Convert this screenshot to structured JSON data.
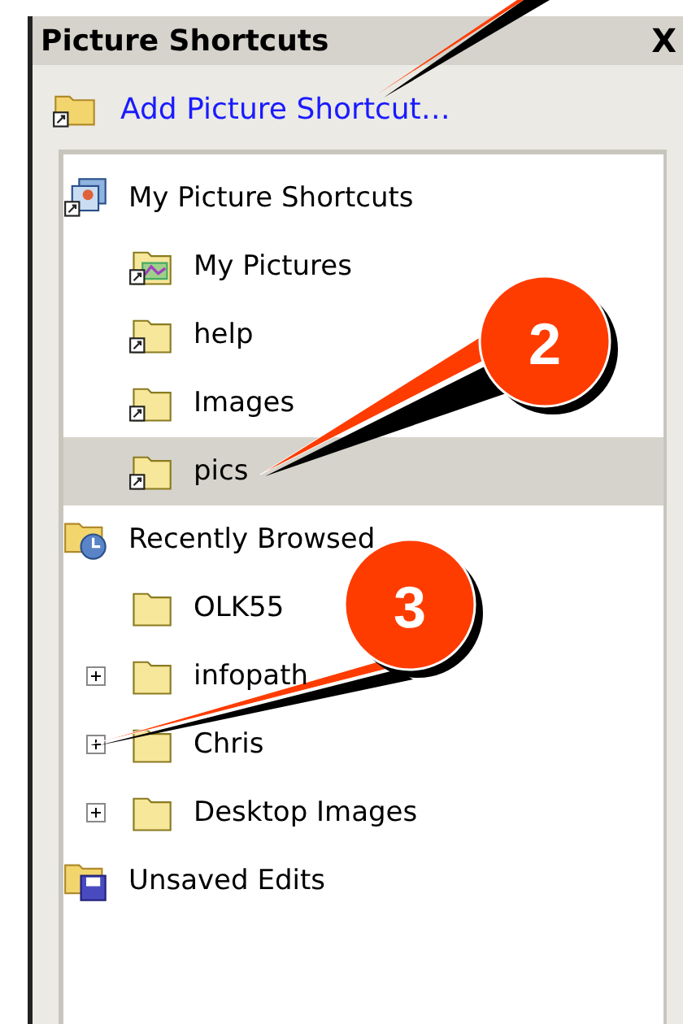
{
  "panel": {
    "title": "Picture Shortcuts",
    "close": "X",
    "add_link": "Add Picture Shortcut…"
  },
  "tree": [
    {
      "label": "My Picture Shortcuts",
      "kind": "shortcut-group",
      "selected": false,
      "children": [
        {
          "label": "My Pictures",
          "kind": "pictures-shortcut",
          "selected": false,
          "expandable": false
        },
        {
          "label": "help",
          "kind": "folder-shortcut",
          "selected": false,
          "expandable": false
        },
        {
          "label": "Images",
          "kind": "folder-shortcut",
          "selected": false,
          "expandable": false
        },
        {
          "label": "pics",
          "kind": "folder-shortcut",
          "selected": true,
          "expandable": false
        }
      ]
    },
    {
      "label": "Recently Browsed",
      "kind": "recent",
      "selected": false,
      "children": [
        {
          "label": "OLK55",
          "kind": "folder",
          "selected": false,
          "expandable": false
        },
        {
          "label": "infopath",
          "kind": "folder",
          "selected": false,
          "expandable": true
        },
        {
          "label": "Chris",
          "kind": "folder",
          "selected": false,
          "expandable": true
        },
        {
          "label": "Desktop Images",
          "kind": "folder",
          "selected": false,
          "expandable": true
        }
      ]
    },
    {
      "label": "Unsaved Edits",
      "kind": "unsaved",
      "selected": false
    }
  ],
  "callouts": [
    {
      "number": "2"
    },
    {
      "number": "3"
    }
  ]
}
